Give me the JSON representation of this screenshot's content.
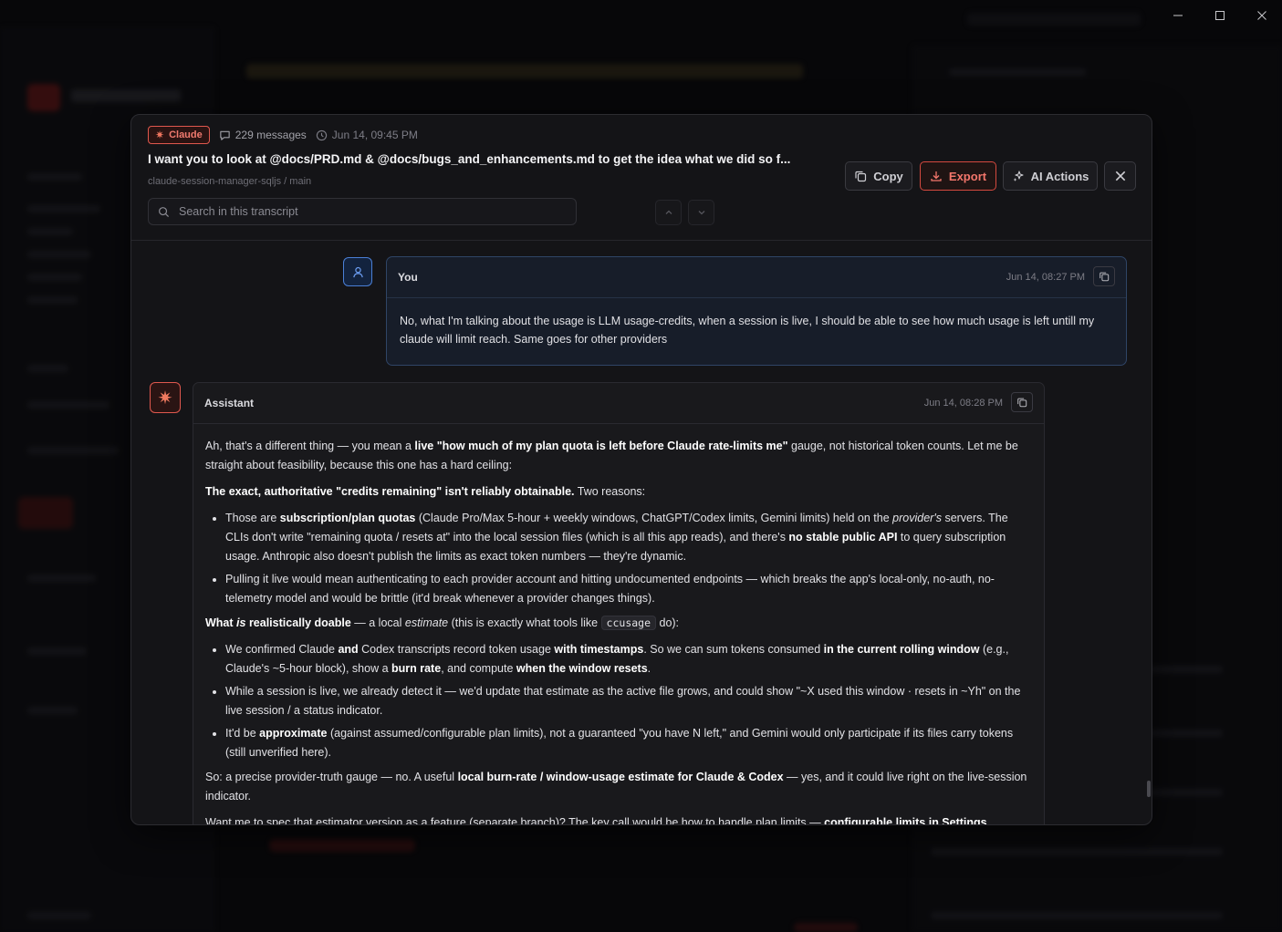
{
  "modal": {
    "provider_badge": "Claude",
    "message_count": "229 messages",
    "timestamp": "Jun 14, 09:45 PM",
    "title": "I want you to look at @docs/PRD.md & @docs/bugs_and_enhancements.md to get the idea what we did so f...",
    "path": "claude-session-manager-sqljs / main",
    "search_placeholder": "Search in this transcript",
    "buttons": {
      "copy": "Copy",
      "export": "Export",
      "ai_actions": "AI Actions"
    }
  },
  "messages": {
    "user": {
      "role": "You",
      "time": "Jun 14, 08:27 PM",
      "text": "No, what I'm talking about the usage is LLM usage-credits, when a session is live, I should be able to see how much usage is left untill my claude will limit reach. Same goes for other providers"
    },
    "assistant": {
      "role": "Assistant",
      "time": "Jun 14, 08:28 PM",
      "p1_a": "Ah, that's a different thing — you mean a ",
      "p1_b": "live \"how much of my plan quota is left before Claude rate-limits me\"",
      "p1_c": " gauge, not historical token counts. Let me be straight about feasibility, because this one has a hard ceiling:",
      "p2_a": "The exact, authoritative \"credits remaining\" isn't reliably obtainable.",
      "p2_b": " Two reasons:",
      "li1_a": "Those are ",
      "li1_b": "subscription/plan quotas",
      "li1_c": " (Claude Pro/Max 5-hour + weekly windows, ChatGPT/Codex limits, Gemini limits) held on the ",
      "li1_d": "provider's",
      "li1_e": " servers. The CLIs don't write \"remaining quota / resets at\" into the local session files (which is all this app reads), and there's ",
      "li1_f": "no stable public API",
      "li1_g": " to query subscription usage. Anthropic also doesn't publish the limits as exact token numbers — they're dynamic.",
      "li2": "Pulling it live would mean authenticating to each provider account and hitting undocumented endpoints — which breaks the app's local-only, no-auth, no-telemetry model and would be brittle (it'd break whenever a provider changes things).",
      "p3_a": "What ",
      "p3_b": "is",
      "p3_c": " realistically doable",
      "p3_d": " — a local ",
      "p3_e": "estimate",
      "p3_f": " (this is exactly what tools like ",
      "p3_code": "ccusage",
      "p3_g": " do):",
      "li3_a": "We confirmed Claude ",
      "li3_b": "and",
      "li3_c": " Codex transcripts record token usage ",
      "li3_d": "with timestamps",
      "li3_e": ". So we can sum tokens consumed ",
      "li3_f": "in the current rolling window",
      "li3_g": " (e.g., Claude's ~5-hour block), show a ",
      "li3_h": "burn rate",
      "li3_i": ", and compute ",
      "li3_j": "when the window resets",
      "li3_k": ".",
      "li4": "While a session is live, we already detect it — we'd update that estimate as the active file grows, and could show \"~X used this window · resets in ~Yh\" on the live session / a status indicator.",
      "li5_a": "It'd be ",
      "li5_b": "approximate",
      "li5_c": " (against assumed/configurable plan limits), not a guaranteed \"you have N left,\" and Gemini would only participate if its files carry tokens (still unverified here).",
      "p4_a": "So: a precise provider-truth gauge — no. A useful ",
      "p4_b": "local burn-rate / window-usage estimate for Claude & Codex",
      "p4_c": " — yes, and it could live right on the live-session indicator.",
      "p5_a": "Want me to spec that estimator version as a feature (separate branch)? The key call would be how to handle plan limits — ",
      "p5_b": "configurable limits in Settings"
    }
  }
}
